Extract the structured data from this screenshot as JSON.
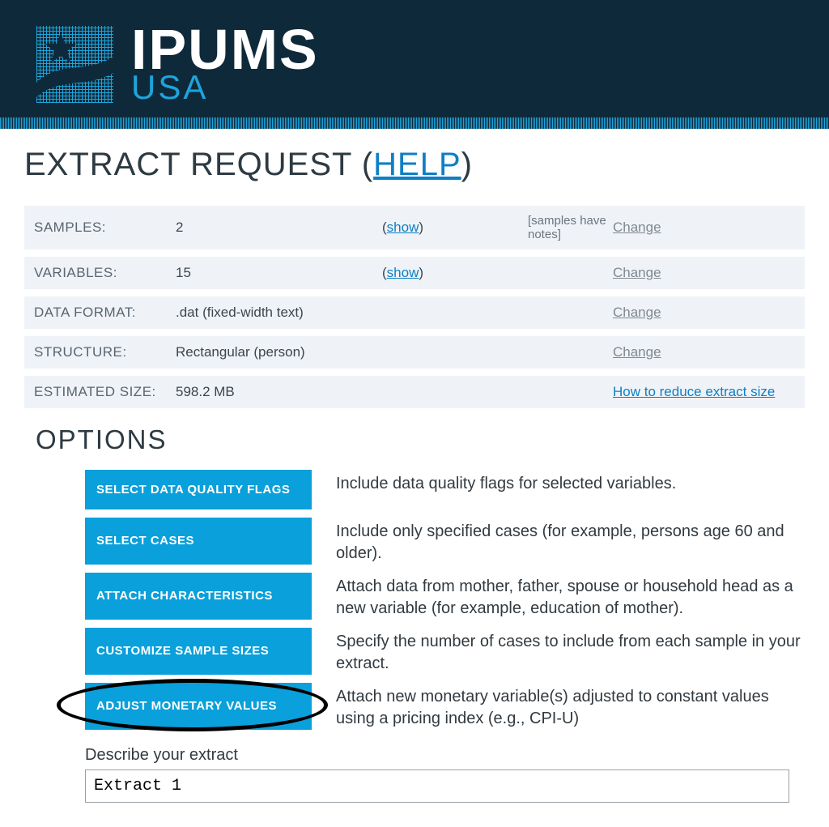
{
  "brand": {
    "ipums": "IPUMS",
    "usa": "USA"
  },
  "page_title": {
    "prefix": "EXTRACT REQUEST (",
    "help": "HELP",
    "suffix": ")"
  },
  "summary": {
    "samples": {
      "label": "SAMPLES:",
      "value": "2",
      "mid_prefix": "(",
      "mid_link": "show",
      "mid_suffix": ")",
      "notes": "[samples have notes]",
      "action": "Change"
    },
    "variables": {
      "label": "VARIABLES:",
      "value": "15",
      "mid_prefix": "(",
      "mid_link": "show",
      "mid_suffix": ")",
      "notes": "",
      "action": "Change"
    },
    "format": {
      "label": "DATA FORMAT:",
      "value": ".dat (fixed-width text)",
      "mid_prefix": "",
      "mid_link": "",
      "mid_suffix": "",
      "notes": "",
      "action": "Change"
    },
    "structure": {
      "label": "STRUCTURE:",
      "value": "Rectangular (person)",
      "mid_prefix": "",
      "mid_link": "",
      "mid_suffix": "",
      "notes": "",
      "action": "Change"
    },
    "size": {
      "label": "ESTIMATED SIZE:",
      "value": "598.2 MB",
      "mid_prefix": "",
      "mid_link": "",
      "mid_suffix": "",
      "notes": "",
      "action": "How to reduce extract size"
    }
  },
  "options_heading": "OPTIONS",
  "options": [
    {
      "btn": "SELECT DATA QUALITY FLAGS",
      "desc": "Include data quality flags for selected variables."
    },
    {
      "btn": "SELECT CASES",
      "desc": "Include only specified cases (for example, persons age 60 and older)."
    },
    {
      "btn": "ATTACH CHARACTERISTICS",
      "desc": "Attach data from mother, father, spouse or household head as a new variable (for example, education of mother)."
    },
    {
      "btn": "CUSTOMIZE SAMPLE SIZES",
      "desc": "Specify the number of cases to include from each sample in your extract."
    },
    {
      "btn": "ADJUST MONETARY VALUES",
      "desc": "Attach new monetary variable(s) adjusted to constant values using a pricing index (e.g., CPI-U)"
    }
  ],
  "describe": {
    "label": "Describe your extract",
    "value": "Extract 1"
  }
}
